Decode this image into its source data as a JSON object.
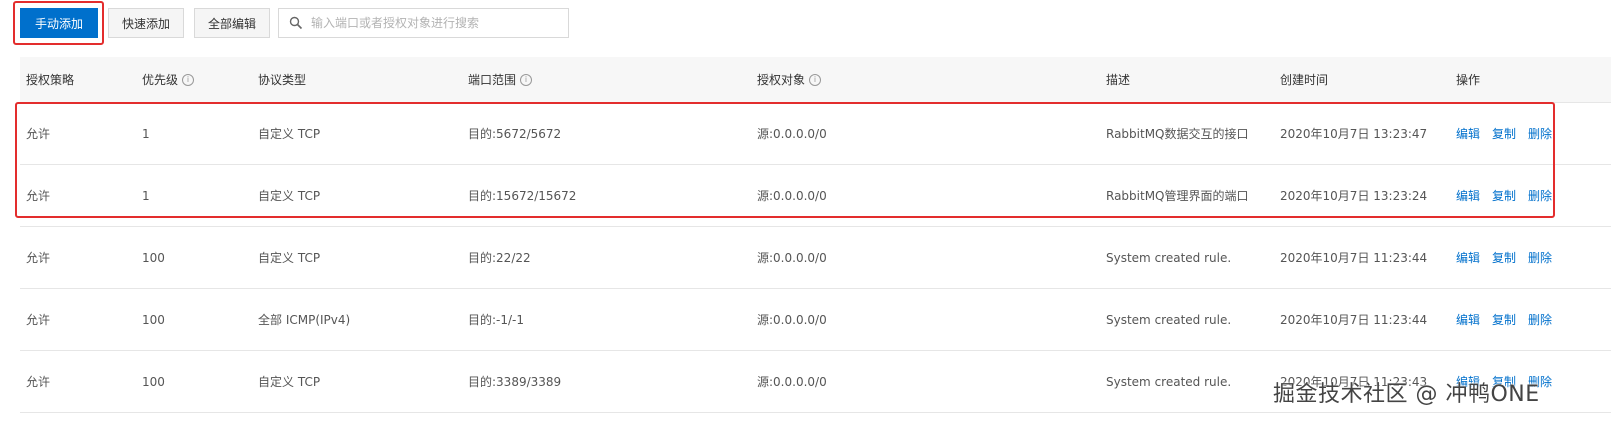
{
  "toolbar": {
    "manual_add_label": "手动添加",
    "quick_add_label": "快速添加",
    "bulk_edit_label": "全部编辑",
    "search_placeholder": "输入端口或者授权对象进行搜索",
    "search_value": ""
  },
  "table": {
    "headers": {
      "policy": "授权策略",
      "priority": "优先级",
      "protocol": "协议类型",
      "port_range": "端口范围",
      "auth_object": "授权对象",
      "description": "描述",
      "created": "创建时间",
      "actions": "操作"
    },
    "rows": [
      {
        "policy": "允许",
        "priority": "1",
        "protocol": "自定义 TCP",
        "port_range": "目的:5672/5672",
        "auth_object": "源:0.0.0.0/0",
        "description": "RabbitMQ数据交互的接口",
        "created": "2020年10月7日 13:23:47",
        "edit": "编辑",
        "copy": "复制",
        "delete": "删除"
      },
      {
        "policy": "允许",
        "priority": "1",
        "protocol": "自定义 TCP",
        "port_range": "目的:15672/15672",
        "auth_object": "源:0.0.0.0/0",
        "description": "RabbitMQ管理界面的端口",
        "created": "2020年10月7日 13:23:24",
        "edit": "编辑",
        "copy": "复制",
        "delete": "删除"
      },
      {
        "policy": "允许",
        "priority": "100",
        "protocol": "自定义 TCP",
        "port_range": "目的:22/22",
        "auth_object": "源:0.0.0.0/0",
        "description": "System created rule.",
        "created": "2020年10月7日 11:23:44",
        "edit": "编辑",
        "copy": "复制",
        "delete": "删除"
      },
      {
        "policy": "允许",
        "priority": "100",
        "protocol": "全部 ICMP(IPv4)",
        "port_range": "目的:-1/-1",
        "auth_object": "源:0.0.0.0/0",
        "description": "System created rule.",
        "created": "2020年10月7日 11:23:44",
        "edit": "编辑",
        "copy": "复制",
        "delete": "删除"
      },
      {
        "policy": "允许",
        "priority": "100",
        "protocol": "自定义 TCP",
        "port_range": "目的:3389/3389",
        "auth_object": "源:0.0.0.0/0",
        "description": "System created rule.",
        "created": "2020年10月7日 11:23:43",
        "edit": "编辑",
        "copy": "复制",
        "delete": "删除"
      }
    ]
  },
  "watermark": "掘金技术社区 @ 冲鸭ONE",
  "colors": {
    "primary": "#0070cc",
    "highlight": "#e32d2d",
    "link": "#0070cc"
  },
  "icons": {
    "search": "search-icon",
    "info": "info-icon"
  }
}
